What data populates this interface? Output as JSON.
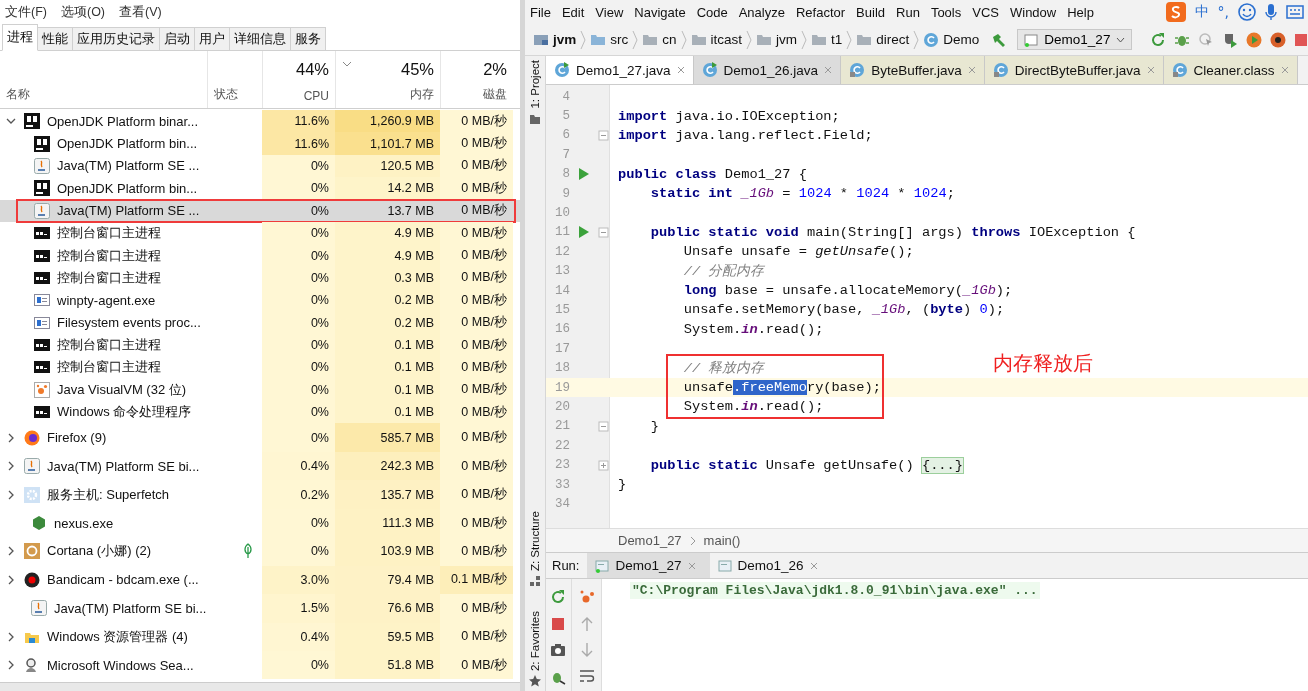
{
  "task_manager": {
    "menu": [
      "文件(F)",
      "选项(O)",
      "查看(V)"
    ],
    "tabs": [
      {
        "label": "进程",
        "selected": true
      },
      {
        "label": "性能",
        "selected": false
      },
      {
        "label": "应用历史记录",
        "selected": false
      },
      {
        "label": "启动",
        "selected": false
      },
      {
        "label": "用户",
        "selected": false
      },
      {
        "label": "详细信息",
        "selected": false
      },
      {
        "label": "服务",
        "selected": false
      }
    ],
    "columns": [
      {
        "label": "名称",
        "sorted": false
      },
      {
        "label": "状态",
        "sorted": false
      },
      {
        "label": "CPU",
        "total": "44%",
        "sorted": false
      },
      {
        "label": "内存",
        "total": "45%",
        "sorted": true
      },
      {
        "label": "磁盘",
        "total": "2%",
        "sorted": false
      }
    ],
    "rows": [
      {
        "name": "OpenJDK Platform binar...",
        "kind": "jb",
        "expanded": true,
        "selected": false,
        "boxed": false,
        "suspended": false,
        "cpu": "11.6%",
        "memory": "1,260.9 MB",
        "disk": "0 MB/秒",
        "children": [
          {
            "name": "OpenJDK Platform bin...",
            "kind": "jb",
            "selected": false,
            "boxed": false,
            "suspended": false,
            "cpu": "11.6%",
            "memory": "1,101.7 MB",
            "disk": "0 MB/秒"
          },
          {
            "name": "Java(TM) Platform SE ...",
            "kind": "java",
            "selected": false,
            "boxed": false,
            "suspended": false,
            "cpu": "0%",
            "memory": "120.5 MB",
            "disk": "0 MB/秒"
          },
          {
            "name": "OpenJDK Platform bin...",
            "kind": "jb",
            "selected": false,
            "boxed": false,
            "suspended": false,
            "cpu": "0%",
            "memory": "14.2 MB",
            "disk": "0 MB/秒"
          },
          {
            "name": "Java(TM) Platform SE ...",
            "kind": "java",
            "selected": true,
            "boxed": true,
            "suspended": false,
            "cpu": "0%",
            "memory": "13.7 MB",
            "disk": "0 MB/秒"
          },
          {
            "name": "控制台窗口主进程",
            "kind": "console",
            "selected": false,
            "boxed": false,
            "suspended": false,
            "cpu": "0%",
            "memory": "4.9 MB",
            "disk": "0 MB/秒"
          },
          {
            "name": "控制台窗口主进程",
            "kind": "console",
            "selected": false,
            "boxed": false,
            "suspended": false,
            "cpu": "0%",
            "memory": "4.9 MB",
            "disk": "0 MB/秒"
          },
          {
            "name": "控制台窗口主进程",
            "kind": "console",
            "selected": false,
            "boxed": false,
            "suspended": false,
            "cpu": "0%",
            "memory": "0.3 MB",
            "disk": "0 MB/秒"
          },
          {
            "name": "winpty-agent.exe",
            "kind": "window",
            "selected": false,
            "boxed": false,
            "suspended": false,
            "cpu": "0%",
            "memory": "0.2 MB",
            "disk": "0 MB/秒"
          },
          {
            "name": "Filesystem events proc...",
            "kind": "window",
            "selected": false,
            "boxed": false,
            "suspended": false,
            "cpu": "0%",
            "memory": "0.2 MB",
            "disk": "0 MB/秒"
          },
          {
            "name": "控制台窗口主进程",
            "kind": "console",
            "selected": false,
            "boxed": false,
            "suspended": false,
            "cpu": "0%",
            "memory": "0.1 MB",
            "disk": "0 MB/秒"
          },
          {
            "name": "控制台窗口主进程",
            "kind": "console",
            "selected": false,
            "boxed": false,
            "suspended": false,
            "cpu": "0%",
            "memory": "0.1 MB",
            "disk": "0 MB/秒"
          },
          {
            "name": "Java VisualVM (32 位)",
            "kind": "dots",
            "selected": false,
            "boxed": false,
            "suspended": false,
            "cpu": "0%",
            "memory": "0.1 MB",
            "disk": "0 MB/秒"
          },
          {
            "name": "Windows 命令处理程序",
            "kind": "console",
            "selected": false,
            "boxed": false,
            "suspended": false,
            "cpu": "0%",
            "memory": "0.1 MB",
            "disk": "0 MB/秒"
          }
        ]
      },
      {
        "name": "Firefox (9)",
        "kind": "globe",
        "expanded": false,
        "selected": false,
        "boxed": false,
        "suspended": false,
        "cpu": "0%",
        "memory": "585.7 MB",
        "disk": "0 MB/秒"
      },
      {
        "name": "Java(TM) Platform SE bi...",
        "kind": "java",
        "expanded": false,
        "selected": false,
        "boxed": false,
        "suspended": false,
        "cpu": "0.4%",
        "memory": "242.3 MB",
        "disk": "0 MB/秒"
      },
      {
        "name": "服务主机: Superfetch",
        "kind": "gear",
        "expanded": false,
        "selected": false,
        "boxed": false,
        "suspended": false,
        "cpu": "0.2%",
        "memory": "135.7 MB",
        "disk": "0 MB/秒"
      },
      {
        "name": "nexus.exe",
        "kind": "cube",
        "selected": false,
        "boxed": false,
        "suspended": false,
        "cpu": "0%",
        "memory": "111.3 MB",
        "disk": "0 MB/秒"
      },
      {
        "name": "Cortana (小娜) (2)",
        "kind": "ring",
        "expanded": false,
        "selected": false,
        "boxed": false,
        "suspended": true,
        "cpu": "0%",
        "memory": "103.9 MB",
        "disk": "0 MB/秒"
      },
      {
        "name": "Bandicam - bdcam.exe (...",
        "kind": "record",
        "expanded": false,
        "selected": false,
        "boxed": false,
        "suspended": false,
        "cpu": "3.0%",
        "memory": "79.4 MB",
        "disk": "0.1 MB/秒"
      },
      {
        "name": "Java(TM) Platform SE bi...",
        "kind": "java",
        "selected": false,
        "boxed": false,
        "suspended": false,
        "cpu": "1.5%",
        "memory": "76.6 MB",
        "disk": "0 MB/秒"
      },
      {
        "name": "Windows 资源管理器 (4)",
        "kind": "folder",
        "expanded": false,
        "selected": false,
        "boxed": false,
        "suspended": false,
        "cpu": "0.4%",
        "memory": "59.5 MB",
        "disk": "0 MB/秒"
      },
      {
        "name": "Microsoft Windows Sea...",
        "kind": "person",
        "expanded": false,
        "selected": false,
        "boxed": false,
        "suspended": false,
        "cpu": "0%",
        "memory": "51.8 MB",
        "disk": "0 MB/秒"
      }
    ]
  },
  "ide": {
    "menu": [
      "File",
      "Edit",
      "View",
      "Navigate",
      "Code",
      "Analyze",
      "Refactor",
      "Build",
      "Run",
      "Tools",
      "VCS",
      "Window",
      "Help"
    ],
    "breadcrumbs": [
      {
        "label": "jvm",
        "kind": "module"
      },
      {
        "label": "src",
        "kind": "folder"
      },
      {
        "label": "cn",
        "kind": "package"
      },
      {
        "label": "itcast",
        "kind": "package"
      },
      {
        "label": "jvm",
        "kind": "package"
      },
      {
        "label": "t1",
        "kind": "package"
      },
      {
        "label": "direct",
        "kind": "package"
      },
      {
        "label": "Demo",
        "kind": "class"
      }
    ],
    "run_config": "Demo1_27",
    "tabs": [
      {
        "label": "Demo1_27.java",
        "selected": true,
        "library": false
      },
      {
        "label": "Demo1_26.java",
        "selected": false,
        "library": false
      },
      {
        "label": "ByteBuffer.java",
        "selected": false,
        "library": true
      },
      {
        "label": "DirectByteBuffer.java",
        "selected": false,
        "library": true
      },
      {
        "label": "Cleaner.class",
        "selected": false,
        "library": true
      }
    ],
    "tool_windows": [
      {
        "label": "1: Project",
        "kind": "project"
      },
      {
        "label": "Z: Structure",
        "kind": "structure"
      },
      {
        "label": "2: Favorites",
        "kind": "favorites"
      }
    ],
    "code_lines": [
      {
        "number": "4",
        "current": false,
        "run": false,
        "kind": "plain",
        "boxed": false
      },
      {
        "number": "5",
        "current": false,
        "run": false,
        "kind": "plain",
        "boxed": false,
        "segments": [
          {
            "text": "import",
            "kind": "kw"
          },
          {
            "text": " java.io.IOException;",
            "kind": "plain"
          }
        ]
      },
      {
        "number": "6",
        "current": false,
        "run": false,
        "kind": "fold-end",
        "boxed": false,
        "segments": [
          {
            "text": "import",
            "kind": "kw"
          },
          {
            "text": " java.lang.reflect.Field;",
            "kind": "plain"
          }
        ]
      },
      {
        "number": "7",
        "current": false,
        "run": false,
        "kind": "plain",
        "boxed": false
      },
      {
        "number": "8",
        "current": false,
        "run": true,
        "kind": "plain",
        "boxed": false,
        "segments": [
          {
            "text": "public class",
            "kind": "kw"
          },
          {
            "text": " Demo1_27 {",
            "kind": "plain"
          }
        ]
      },
      {
        "number": "9",
        "current": false,
        "run": false,
        "kind": "plain",
        "boxed": false,
        "segments": [
          {
            "text": "    static int ",
            "kind": "kw"
          },
          {
            "text": "_1Gb",
            "kind": "field"
          },
          {
            "text": " = ",
            "kind": "plain"
          },
          {
            "text": "1024",
            "kind": "num"
          },
          {
            "text": " * ",
            "kind": "plain"
          },
          {
            "text": "1024",
            "kind": "num"
          },
          {
            "text": " * ",
            "kind": "plain"
          },
          {
            "text": "1024",
            "kind": "num"
          },
          {
            "text": ";",
            "kind": "plain"
          }
        ]
      },
      {
        "number": "10",
        "current": false,
        "run": false,
        "kind": "plain",
        "boxed": false
      },
      {
        "number": "11",
        "current": false,
        "run": true,
        "kind": "fold-start",
        "boxed": false,
        "segments": [
          {
            "text": "    public static void",
            "kind": "kw"
          },
          {
            "text": " main(String[] args) ",
            "kind": "plain"
          },
          {
            "text": "throws",
            "kind": "kw"
          },
          {
            "text": " IOException {",
            "kind": "plain"
          }
        ]
      },
      {
        "number": "12",
        "current": false,
        "run": false,
        "kind": "plain",
        "boxed": false,
        "segments": [
          {
            "text": "        Unsafe unsafe = ",
            "kind": "plain"
          },
          {
            "text": "getUnsafe",
            "kind": "call"
          },
          {
            "text": "();",
            "kind": "plain"
          }
        ]
      },
      {
        "number": "13",
        "current": false,
        "run": false,
        "kind": "plain",
        "boxed": false,
        "segments": [
          {
            "text": "        // 分配内存",
            "kind": "comment"
          }
        ]
      },
      {
        "number": "14",
        "current": false,
        "run": false,
        "kind": "plain",
        "boxed": false,
        "segments": [
          {
            "text": "        long",
            "kind": "kw"
          },
          {
            "text": " base = unsafe.allocateMemory(",
            "kind": "plain"
          },
          {
            "text": "_1Gb",
            "kind": "field"
          },
          {
            "text": ");",
            "kind": "plain"
          }
        ]
      },
      {
        "number": "15",
        "current": false,
        "run": false,
        "kind": "plain",
        "boxed": false,
        "segments": [
          {
            "text": "        unsafe.setMemory(base, ",
            "kind": "plain"
          },
          {
            "text": "_1Gb",
            "kind": "field"
          },
          {
            "text": ", (",
            "kind": "plain"
          },
          {
            "text": "byte",
            "kind": "kw"
          },
          {
            "text": ") ",
            "kind": "plain"
          },
          {
            "text": "0",
            "kind": "num"
          },
          {
            "text": ");",
            "kind": "plain"
          }
        ]
      },
      {
        "number": "16",
        "current": false,
        "run": false,
        "kind": "plain",
        "boxed": false,
        "segments": [
          {
            "text": "        System.",
            "kind": "plain"
          },
          {
            "text": "in",
            "kind": "static"
          },
          {
            "text": ".read();",
            "kind": "plain"
          }
        ]
      },
      {
        "number": "17",
        "current": false,
        "run": false,
        "kind": "plain",
        "boxed": false
      },
      {
        "number": "18",
        "current": false,
        "run": false,
        "kind": "plain",
        "boxed": true,
        "segments": [
          {
            "text": "        // 释放内存",
            "kind": "comment"
          }
        ]
      },
      {
        "number": "19",
        "current": true,
        "run": false,
        "kind": "plain",
        "boxed": true,
        "segments": [
          {
            "text": "        unsafe",
            "kind": "plain"
          },
          {
            "text": ".freeMemo",
            "kind": "sel"
          },
          {
            "text": "ry(base);",
            "kind": "plain"
          }
        ]
      },
      {
        "number": "20",
        "current": false,
        "run": false,
        "kind": "plain",
        "boxed": true,
        "segments": [
          {
            "text": "        System.",
            "kind": "plain"
          },
          {
            "text": "in",
            "kind": "static"
          },
          {
            "text": ".read();",
            "kind": "plain"
          }
        ]
      },
      {
        "number": "21",
        "current": false,
        "run": false,
        "kind": "fold-end",
        "boxed": false,
        "segments": [
          {
            "text": "    }",
            "kind": "plain"
          }
        ]
      },
      {
        "number": "22",
        "current": false,
        "run": false,
        "kind": "plain",
        "boxed": false
      },
      {
        "number": "23",
        "current": false,
        "run": false,
        "kind": "folded",
        "boxed": false,
        "segments": [
          {
            "text": "    public static",
            "kind": "kw"
          },
          {
            "text": " Unsafe getUnsafe() ",
            "kind": "plain"
          },
          {
            "text": "{...}",
            "kind": "fold"
          }
        ]
      },
      {
        "number": "33",
        "current": false,
        "run": false,
        "kind": "plain",
        "boxed": false,
        "segments": [
          {
            "text": "}",
            "kind": "plain"
          }
        ]
      },
      {
        "number": "34",
        "current": false,
        "run": false,
        "kind": "plain",
        "boxed": false
      }
    ],
    "annotation": "内存释放后",
    "code_path": [
      "Demo1_27",
      "main()"
    ],
    "run_panel": {
      "label": "Run:",
      "tabs": [
        {
          "label": "Demo1_27",
          "selected": true
        },
        {
          "label": "Demo1_26",
          "selected": false
        }
      ],
      "output": "\"C:\\Program Files\\Java\\jdk1.8.0_91\\bin\\java.exe\" ..."
    }
  },
  "ime": {
    "mode": "中",
    "punctuation": "°,"
  }
}
